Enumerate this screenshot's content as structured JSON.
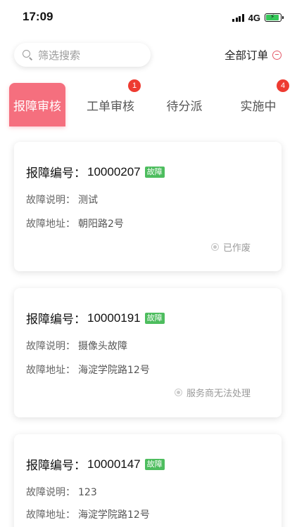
{
  "status_bar": {
    "time": "17:09",
    "network": "4G",
    "battery_level": 0.9,
    "battery_color": "#35c759"
  },
  "search": {
    "placeholder": "筛选搜索",
    "icon": "search-icon"
  },
  "filter": {
    "label": "全部订单",
    "icon": "minus-circle-icon"
  },
  "tabs": [
    {
      "label": "报障审核",
      "active": true,
      "badge": ""
    },
    {
      "label": "工单审核",
      "active": false,
      "badge": "1"
    },
    {
      "label": "待分派",
      "active": false,
      "badge": ""
    },
    {
      "label": "实施中",
      "active": false,
      "badge": "4"
    }
  ],
  "colors": {
    "accent": "#f56f7e",
    "badge": "#ee3b31",
    "tag": "#4dbd5e"
  },
  "cards": [
    {
      "title_label": "报障编号：",
      "number": "10000207",
      "tag": "故障",
      "desc_label": "故障说明：",
      "desc_value": "测试",
      "addr_label": "故障地址：",
      "addr_value": "朝阳路2号",
      "status": "已作废"
    },
    {
      "title_label": "报障编号：",
      "number": "10000191",
      "tag": "故障",
      "desc_label": "故障说明：",
      "desc_value": "摄像头故障",
      "addr_label": "故障地址：",
      "addr_value": "海淀学院路12号",
      "status": "服务商无法处理"
    },
    {
      "title_label": "报障编号：",
      "number": "10000147",
      "tag": "故障",
      "desc_label": "故障说明：",
      "desc_value": "123",
      "addr_label": "故障地址：",
      "addr_value": "海淀学院路12号",
      "status": ""
    }
  ]
}
